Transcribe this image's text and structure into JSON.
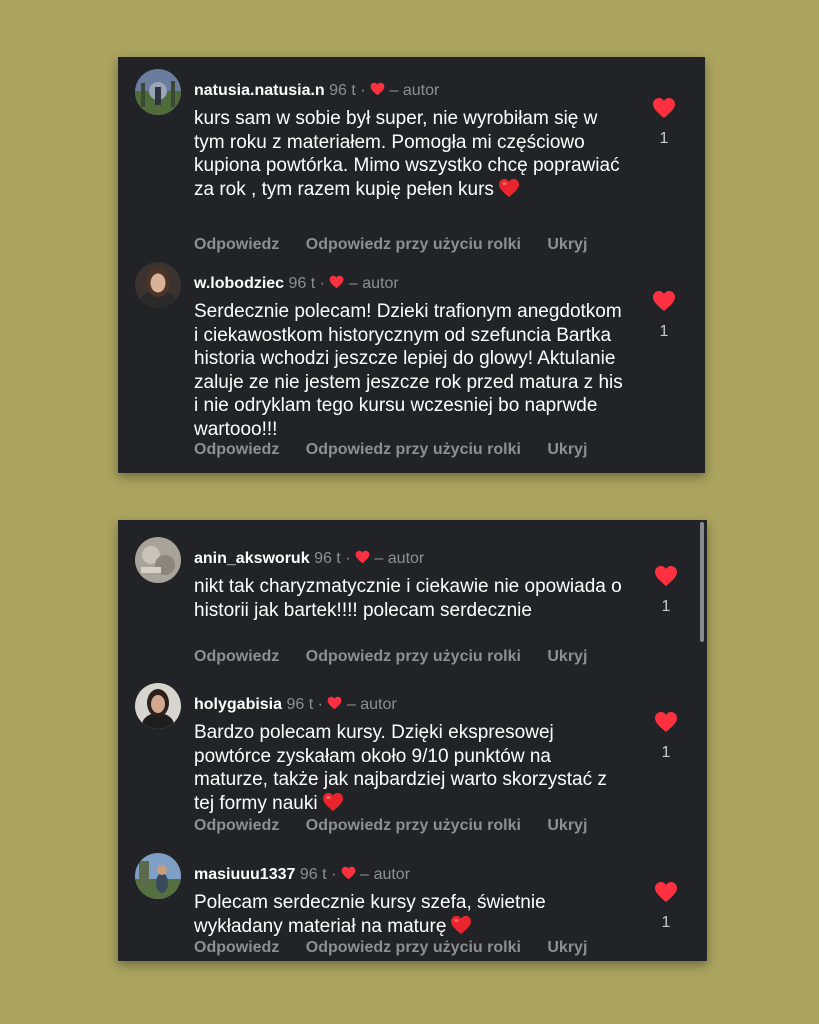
{
  "panels": [
    {
      "comments": [
        {
          "username": "natusia.natusia.n",
          "time": "96 t",
          "dot": "·",
          "author_label": "– autor",
          "text": "kurs sam w sobie był super, nie wyrobiłam się w tym roku z materiałem. Pomogła mi częściowo kupiona powtórka. Mimo wszystko chcę poprawiać za rok , tym razem kupię pełen kurs",
          "emoji": "red-heart",
          "likes": "1",
          "avatar": "landscape-avatar"
        },
        {
          "username": "w.lobodziec",
          "time": "96 t",
          "dot": "·",
          "author_label": "– autor",
          "text": "Serdecznie polecam! Dzieki trafionym anegdotkom i ciekawostkom historycznym od szefuncia Bartka historia wchodzi jeszcze lepiej do glowy! Aktulanie zaluje ze nie jestem jeszcze rok przed matura z his i nie odryklam tego kursu wczesniej bo naprwde wartooo!!!",
          "emoji": "",
          "likes": "1",
          "avatar": "portrait-avatar"
        }
      ]
    },
    {
      "comments": [
        {
          "username": "anin_aksworuk",
          "time": "96 t",
          "dot": "·",
          "author_label": "– autor",
          "text": "nikt tak charyzmatycznie i ciekawie nie opowiada o historii jak bartek!!!! polecam serdecznie",
          "emoji": "",
          "likes": "1",
          "avatar": "grey-avatar"
        },
        {
          "username": "holygabisia",
          "time": "96 t",
          "dot": "·",
          "author_label": "– autor",
          "text": "Bardzo polecam kursy. Dzięki ekspresowej powtórce zyskałam około 9/10 punktów na maturze, także jak najbardziej warto skorzystać z tej formy nauki",
          "emoji": "red-heart",
          "likes": "1",
          "avatar": "portrait-avatar"
        },
        {
          "username": "masiuuu1337",
          "time": "96 t",
          "dot": "·",
          "author_label": "– autor",
          "text": "Polecam serdecznie kursy szefa, świetnie wykładany materiał na maturę",
          "emoji": "red-heart",
          "likes": "1",
          "avatar": "outdoor-avatar"
        }
      ]
    }
  ],
  "actions": {
    "reply": "Odpowiedz",
    "reel_reply": "Odpowiedz przy użyciu rolki",
    "hide": "Ukryj"
  },
  "colors": {
    "background": "#aaa45f",
    "panel": "#222327",
    "like": "#ff3040",
    "muted": "#8e8e93"
  }
}
